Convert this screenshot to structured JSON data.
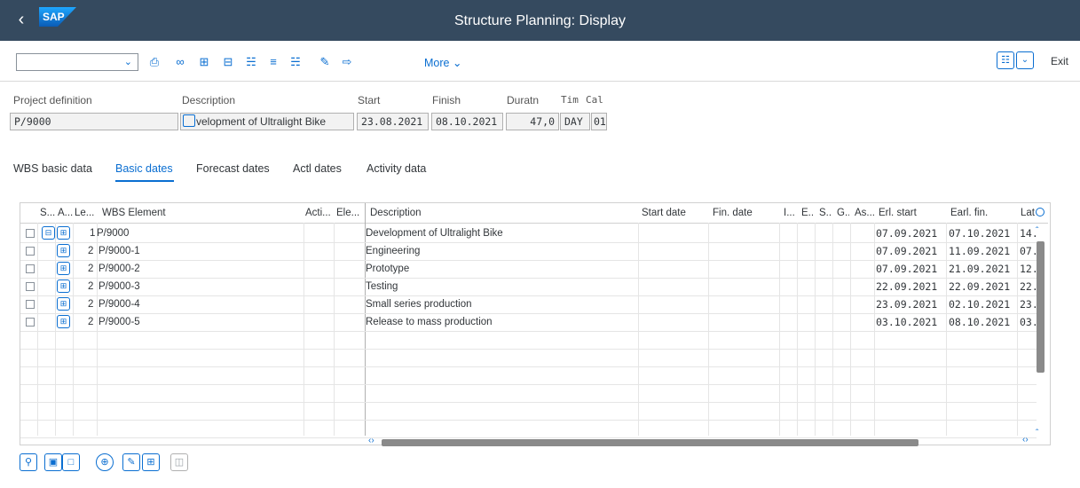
{
  "window": {
    "title": "Structure Planning: Display",
    "logo_text": "SAP"
  },
  "toolbar": {
    "more_label": "More",
    "exit_label": "Exit",
    "command_field_value": "",
    "icons": [
      "print-icon",
      "link-icon",
      "expand-icon",
      "collapse-icon",
      "hierarchy-icon",
      "align-icon",
      "structure-icon",
      "edit-icon",
      "transfer-icon"
    ]
  },
  "header": {
    "labels": {
      "project_definition": "Project definition",
      "description": "Description",
      "start": "Start",
      "finish": "Finish",
      "duration": "Duratn",
      "time_unit": "Tim",
      "calendar": "Cal"
    },
    "values": {
      "project_definition": "P/9000",
      "description": "velopment of Ultralight Bike",
      "start": "23.08.2021",
      "finish": "08.10.2021",
      "duration": "47,0",
      "time_unit": "DAY",
      "calendar": "01"
    }
  },
  "tabs": [
    "WBS basic data",
    "Basic dates",
    "Forecast dates",
    "Actl dates",
    "Activity data"
  ],
  "active_tab": "Basic dates",
  "table": {
    "columns": [
      "S...",
      "A...",
      "Le...",
      "WBS Element",
      "Acti...",
      "Ele...",
      "Description",
      "Start date",
      "Fin. date",
      "I...",
      "E...",
      "S...",
      "G...",
      "As...",
      "Erl. start",
      "Earl. fin.",
      "Lat"
    ],
    "rows": [
      {
        "level": "1",
        "wbs": "P/9000",
        "description": "Development of Ultralight Bike",
        "erl_start": "07.09.2021",
        "earl_fin": "07.10.2021",
        "lat": "14."
      },
      {
        "level": "2",
        "wbs": "P/9000-1",
        "description": "Engineering",
        "erl_start": "07.09.2021",
        "earl_fin": "11.09.2021",
        "lat": "07."
      },
      {
        "level": "2",
        "wbs": "P/9000-2",
        "description": "Prototype",
        "erl_start": "07.09.2021",
        "earl_fin": "21.09.2021",
        "lat": "12."
      },
      {
        "level": "2",
        "wbs": "P/9000-3",
        "description": "Testing",
        "erl_start": "22.09.2021",
        "earl_fin": "22.09.2021",
        "lat": "22."
      },
      {
        "level": "2",
        "wbs": "P/9000-4",
        "description": "Small series production",
        "erl_start": "23.09.2021",
        "earl_fin": "02.10.2021",
        "lat": "23."
      },
      {
        "level": "2",
        "wbs": "P/9000-5",
        "description": "Release to mass production",
        "erl_start": "03.10.2021",
        "earl_fin": "08.10.2021",
        "lat": "03."
      }
    ]
  },
  "colors": {
    "shell": "#354a5f",
    "accent": "#0a6ed1",
    "text": "#32363a"
  }
}
